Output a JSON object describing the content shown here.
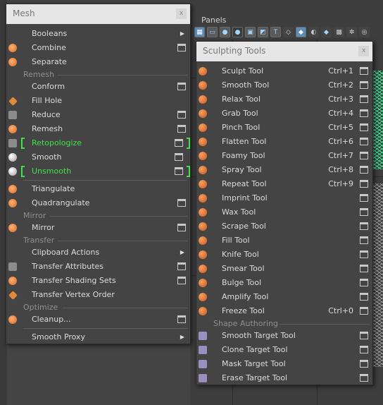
{
  "panels": {
    "label": "Panels",
    "toolbar_icons": [
      "grid-icon",
      "film-icon",
      "camera-icon",
      "sphere-icon",
      "image-icon",
      "lights-icon",
      "text-icon",
      "wire-cube-icon",
      "shaded-cube-icon",
      "textured-icon",
      "xray-icon",
      "checker-icon",
      "isolate-icon",
      "eye-icon"
    ]
  },
  "mesh_menu": {
    "title": "Mesh",
    "close": "x",
    "items": [
      {
        "label": "Booleans",
        "type": "submenu"
      },
      {
        "label": "Combine",
        "type": "option"
      },
      {
        "label": "Separate",
        "type": "plain"
      }
    ],
    "sections": {
      "remesh": "Remesh",
      "mirror": "Mirror",
      "transfer": "Transfer",
      "optimize": "Optimize"
    },
    "remesh_items": [
      {
        "label": "Conform",
        "type": "option"
      },
      {
        "label": "Fill Hole",
        "type": "plain"
      },
      {
        "label": "Reduce",
        "type": "option"
      },
      {
        "label": "Remesh",
        "type": "option"
      },
      {
        "label": "Retopologize",
        "type": "option"
      },
      {
        "label": "Smooth",
        "type": "option"
      },
      {
        "label": "Unsmooth",
        "type": "option"
      }
    ],
    "tri_items": [
      {
        "label": "Triangulate"
      },
      {
        "label": "Quadrangulate"
      }
    ],
    "mirror_items": [
      {
        "label": "Mirror"
      }
    ],
    "transfer_items": [
      {
        "label": "Clipboard Actions",
        "type": "submenu"
      },
      {
        "label": "Transfer Attributes",
        "type": "option"
      },
      {
        "label": "Transfer Shading Sets",
        "type": "option"
      },
      {
        "label": "Transfer Vertex Order",
        "type": "plain"
      }
    ],
    "optimize_items": [
      {
        "label": "Cleanup..."
      }
    ],
    "footer_items": [
      {
        "label": "Smooth Proxy"
      }
    ]
  },
  "sculpt_menu": {
    "title": "Sculpting Tools",
    "close": "x",
    "tools": [
      {
        "label": "Sculpt Tool",
        "shortcut": "Ctrl+1"
      },
      {
        "label": "Smooth Tool",
        "shortcut": "Ctrl+2"
      },
      {
        "label": "Relax Tool",
        "shortcut": "Ctrl+3"
      },
      {
        "label": "Grab Tool",
        "shortcut": "Ctrl+4"
      },
      {
        "label": "Pinch Tool",
        "shortcut": "Ctrl+5"
      },
      {
        "label": "Flatten Tool",
        "shortcut": "Ctrl+6"
      },
      {
        "label": "Foamy Tool",
        "shortcut": "Ctrl+7"
      },
      {
        "label": "Spray Tool",
        "shortcut": "Ctrl+8"
      },
      {
        "label": "Repeat Tool",
        "shortcut": "Ctrl+9"
      },
      {
        "label": "Imprint Tool",
        "shortcut": ""
      },
      {
        "label": "Wax Tool",
        "shortcut": ""
      },
      {
        "label": "Scrape Tool",
        "shortcut": ""
      },
      {
        "label": "Fill Tool",
        "shortcut": ""
      },
      {
        "label": "Knife Tool",
        "shortcut": ""
      },
      {
        "label": "Smear Tool",
        "shortcut": ""
      },
      {
        "label": "Bulge Tool",
        "shortcut": ""
      },
      {
        "label": "Amplify Tool",
        "shortcut": ""
      },
      {
        "label": "Freeze Tool",
        "shortcut": "Ctrl+0"
      }
    ],
    "section_shape": "Shape Authoring",
    "shape_tools": [
      {
        "label": "Smooth Target Tool"
      },
      {
        "label": "Clone Target Tool"
      },
      {
        "label": "Mask Target Tool"
      },
      {
        "label": "Erase Target Tool"
      }
    ]
  },
  "colors": {
    "highlight_green": "#44e04a",
    "menu_bg": "#444444",
    "title_bg": "#e6e6e6"
  }
}
